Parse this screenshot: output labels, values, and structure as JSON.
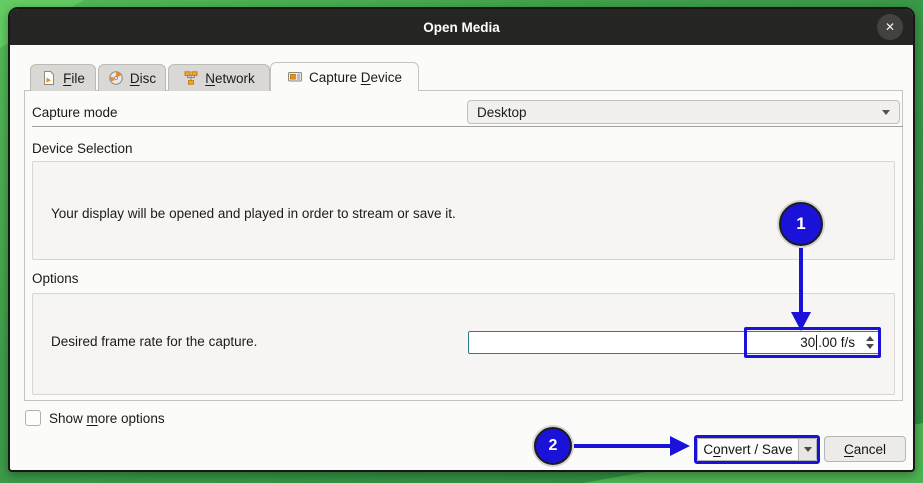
{
  "titlebar": {
    "title": "Open Media",
    "close": "✕"
  },
  "tabs": [
    {
      "label_pre": "",
      "label_u": "F",
      "label_post": "ile"
    },
    {
      "label_pre": "",
      "label_u": "D",
      "label_post": "isc"
    },
    {
      "label_pre": "",
      "label_u": "N",
      "label_post": "etwork"
    },
    {
      "label_pre": "Capture ",
      "label_u": "D",
      "label_post": "evice"
    }
  ],
  "capture_mode": {
    "label": "Capture mode",
    "value": "Desktop"
  },
  "device_selection": {
    "heading": "Device Selection",
    "message": "Your display will be opened and played in order to stream or save it."
  },
  "options": {
    "heading": "Options",
    "frame_rate_label": "Desired frame rate for the capture.",
    "frame_rate_value_pre": "30",
    "frame_rate_value_post": ".00 f/s"
  },
  "footer": {
    "show_more": {
      "label_pre": "Show ",
      "label_u": "m",
      "label_post": "ore options"
    },
    "convert_save": {
      "label_pre": "C",
      "label_u": "o",
      "label_post": "nvert / Save"
    },
    "cancel": {
      "label_pre": "",
      "label_u": "C",
      "label_post": "ancel"
    }
  },
  "annotations": {
    "step1": "1",
    "step2": "2"
  },
  "colors": {
    "annotation_blue": "#1a12d8",
    "focus_teal": "#2d7b8f",
    "titlebar_bg": "#252523",
    "desktop_green": "#3fa04a",
    "accent_orange": "#f08c1e"
  }
}
